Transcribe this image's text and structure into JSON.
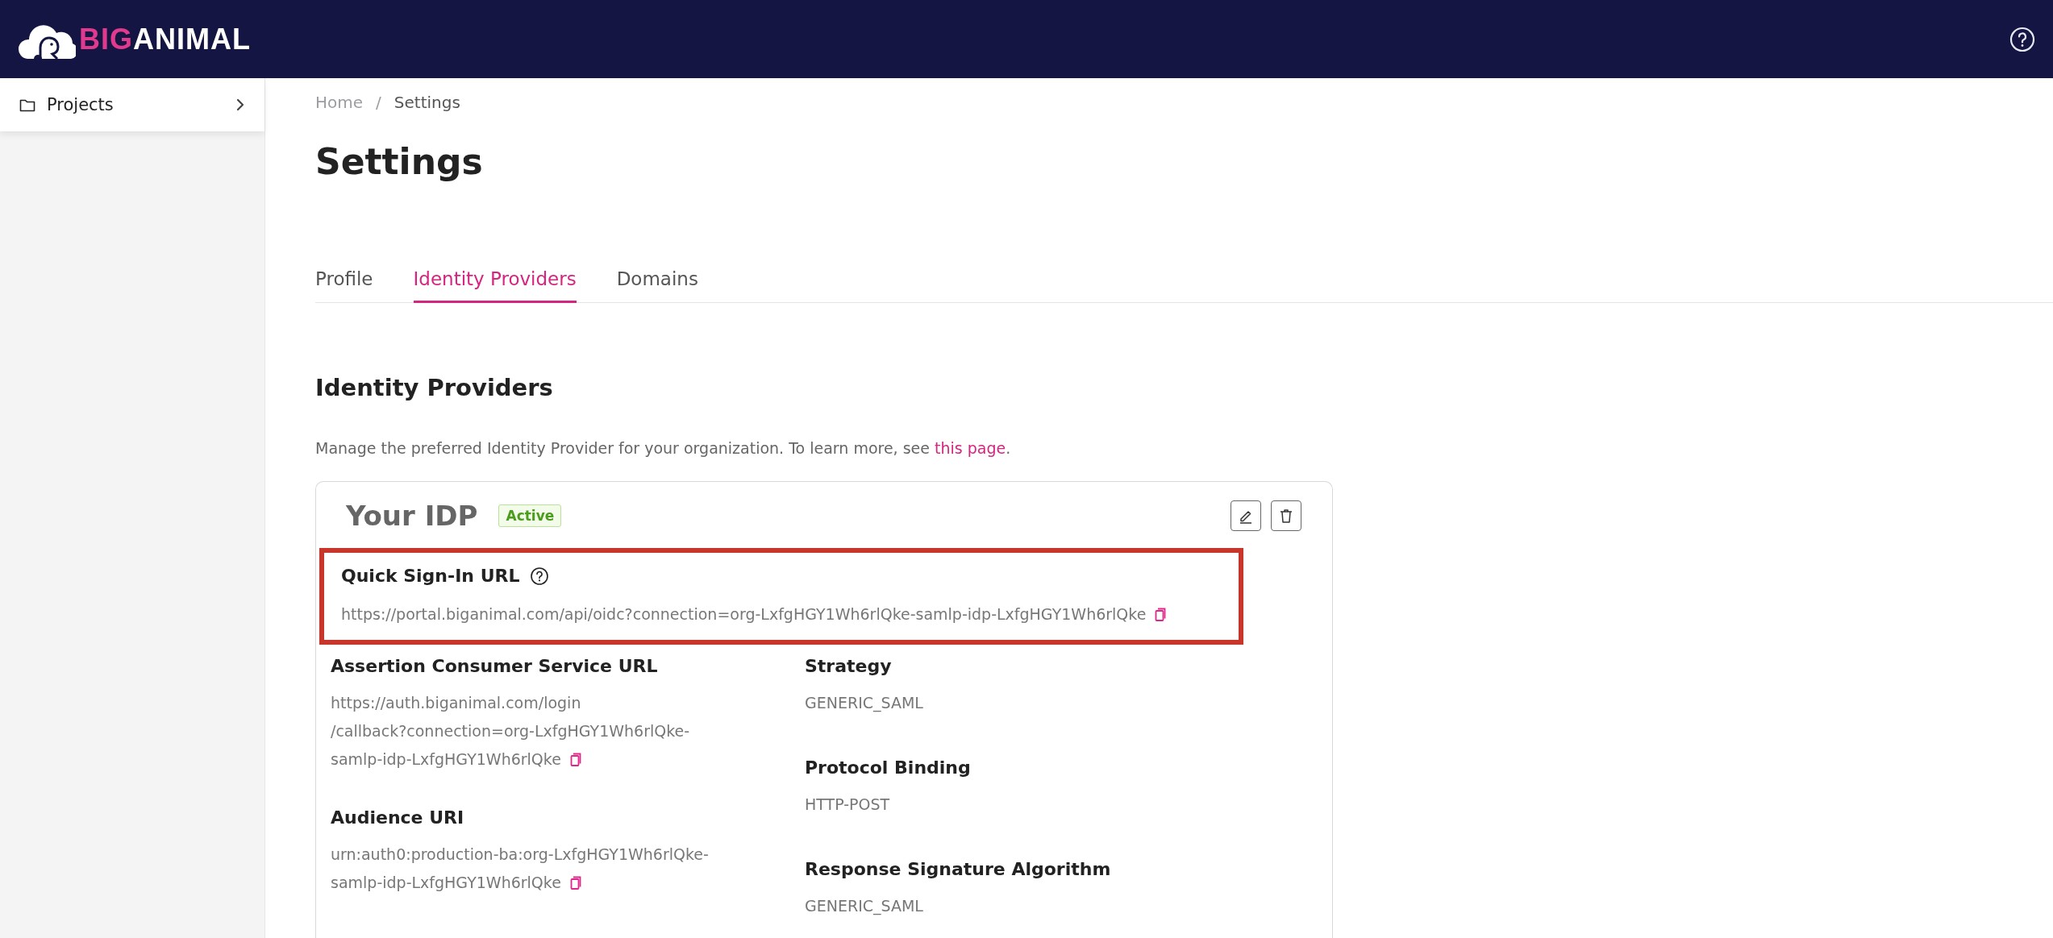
{
  "header": {
    "logo": {
      "accent": "BIG",
      "rest": "ANIMAL"
    }
  },
  "sidebar": {
    "items": [
      {
        "label": "Projects"
      }
    ]
  },
  "breadcrumb": {
    "items": [
      "Home",
      "Settings"
    ],
    "separator": "/"
  },
  "page_title": "Settings",
  "tabs": [
    {
      "label": "Profile",
      "selected": false
    },
    {
      "label": "Identity Providers",
      "selected": true
    },
    {
      "label": "Domains",
      "selected": false
    }
  ],
  "section": {
    "title": "Identity Providers",
    "description": "Manage the preferred Identity Provider for your organization. To learn more, see ",
    "link": "this page",
    "description_end": "."
  },
  "idp_card": {
    "name": "Your IDP",
    "status": "Active",
    "quick_sign_in": {
      "label": "Quick Sign-In URL",
      "value_lines": [
        "https://portal.biganimal.com/api/oidc?connection=org-LxfgHGY1Wh6rlQke-samlp-idp-LxfgHGY1Wh6rlQke"
      ],
      "has_help": true,
      "copyable": true,
      "highlighted": true
    },
    "left_fields": [
      {
        "label": "Assertion Consumer Service URL",
        "value_lines": [
          "https://auth.biganimal.com/login",
          "/callback?connection=org-LxfgHGY1Wh6rlQke-",
          "samlp-idp-LxfgHGY1Wh6rlQke"
        ],
        "has_help": false,
        "copyable": true,
        "highlighted": false
      },
      {
        "label": "Audience URI",
        "value_lines": [
          "urn:auth0:production-ba:org-LxfgHGY1Wh6rlQke-",
          "samlp-idp-LxfgHGY1Wh6rlQke"
        ],
        "has_help": false,
        "copyable": true,
        "highlighted": false
      }
    ],
    "right_fields": [
      {
        "label": "Strategy",
        "value_lines": [
          "GENERIC_SAML"
        ],
        "has_help": false,
        "copyable": false,
        "highlighted": false
      },
      {
        "label": "Protocol Binding",
        "value_lines": [
          "HTTP-POST"
        ],
        "has_help": false,
        "copyable": false,
        "highlighted": false
      },
      {
        "label": "Response Signature Algorithm",
        "value_lines": [
          "GENERIC_SAML"
        ],
        "has_help": false,
        "copyable": false,
        "highlighted": false
      }
    ]
  }
}
